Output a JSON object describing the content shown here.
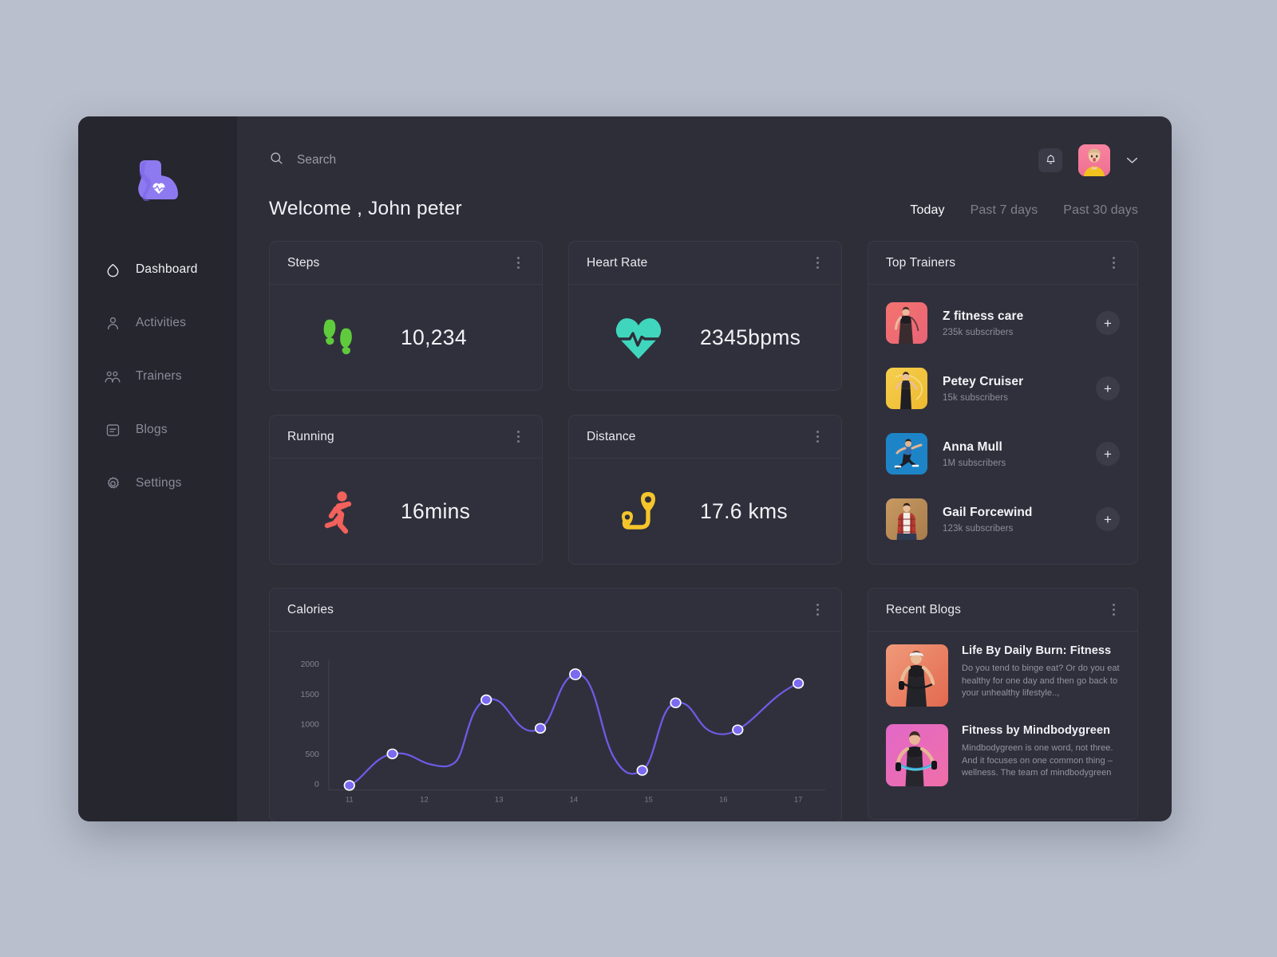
{
  "brand": {
    "logo_icon": "flexed-biceps-heart-logo",
    "accent": "#7b63e8"
  },
  "sidebar": {
    "items": [
      {
        "label": "Dashboard",
        "icon": "home-icon",
        "active": true
      },
      {
        "label": "Activities",
        "icon": "user-icon",
        "active": false
      },
      {
        "label": "Trainers",
        "icon": "users-icon",
        "active": false
      },
      {
        "label": "Blogs",
        "icon": "article-icon",
        "active": false
      },
      {
        "label": "Settings",
        "icon": "gear-icon",
        "active": false
      }
    ]
  },
  "topbar": {
    "search_placeholder": "Search",
    "search_value": "",
    "search_icon": "search-icon",
    "bell_icon": "bell-icon",
    "avatar_icon": "user-avatar",
    "chevron_icon": "chevron-down-icon"
  },
  "header": {
    "welcome": "Welcome , John peter",
    "ranges": [
      {
        "label": "Today",
        "active": true
      },
      {
        "label": "Past 7 days",
        "active": false
      },
      {
        "label": "Past 30 days",
        "active": false
      }
    ]
  },
  "stats": [
    {
      "title": "Steps",
      "value": "10,234",
      "icon": "footprints-icon",
      "color": "#5fcb3c"
    },
    {
      "title": "Heart Rate",
      "value": "2345bpms",
      "icon": "heartbeat-icon",
      "color": "#3fd6bd"
    },
    {
      "title": "Running",
      "value": "16mins",
      "icon": "runner-icon",
      "color": "#f2615c"
    },
    {
      "title": "Distance",
      "value": "17.6 kms",
      "icon": "route-pin-icon",
      "color": "#f5c52b"
    }
  ],
  "calories": {
    "title": "Calories"
  },
  "chart_data": {
    "type": "line",
    "title": "Calories",
    "xlabel": "",
    "ylabel": "",
    "x": [
      "11",
      "12",
      "13",
      "14",
      "15",
      "16",
      "17"
    ],
    "categories": [
      "11",
      "12",
      "13",
      "14",
      "15",
      "16",
      "17"
    ],
    "values": [
      100,
      520,
      1500,
      1030,
      1900,
      380,
      1450
    ],
    "points": [
      {
        "x": "11",
        "y": 100
      },
      {
        "x": "12",
        "y": 520
      },
      {
        "x": "13",
        "y": 1500
      },
      {
        "x": "13.5",
        "y": 1030
      },
      {
        "x": "14",
        "y": 1900
      },
      {
        "x": "15",
        "y": 380
      },
      {
        "x": "15.5",
        "y": 1450
      },
      {
        "x": "16",
        "y": 950
      },
      {
        "x": "17",
        "y": 1760
      }
    ],
    "series": [
      {
        "name": "Calories",
        "values": [
          100,
          520,
          1500,
          1030,
          1900,
          380,
          1450,
          950,
          1760
        ]
      }
    ],
    "ytick_labels": [
      "2000",
      "1500",
      "1000",
      "500",
      "0"
    ],
    "yticks": [
      2000,
      1500,
      1000,
      500,
      0
    ],
    "ylim": [
      0,
      2200
    ],
    "xtick_labels": [
      "11",
      "12",
      "13",
      "14",
      "15",
      "16",
      "17"
    ],
    "grid": false,
    "legend": "none",
    "line_color": "#6c5ce7",
    "point_fill": "#7a6bf0",
    "point_stroke": "#ffffff"
  },
  "trainers": {
    "title": "Top Trainers",
    "add_label": "+",
    "items": [
      {
        "name": "Z fitness care",
        "subs": "235k subscribers",
        "thumb": "trainer-photo-red"
      },
      {
        "name": "Petey Cruiser",
        "subs": "15k subscribers",
        "thumb": "trainer-photo-yellow"
      },
      {
        "name": "Anna Mull",
        "subs": "1M subscribers",
        "thumb": "trainer-photo-blue"
      },
      {
        "name": "Gail Forcewind",
        "subs": "123k subscribers",
        "thumb": "trainer-photo-tan"
      }
    ]
  },
  "blogs": {
    "title": "Recent Blogs",
    "items": [
      {
        "title": "Life By Daily Burn: Fitness",
        "desc": "Do you tend to binge eat? Or do you eat healthy for one day and then go back to your unhealthy lifestyle..,",
        "thumb": "blog-photo-orange"
      },
      {
        "title": "Fitness by Mindbodygreen",
        "desc": "Mindbodygreen is one word, not three. And it focuses on one common thing – wellness. The team of mindbodygreen",
        "thumb": "blog-photo-pink"
      }
    ]
  }
}
